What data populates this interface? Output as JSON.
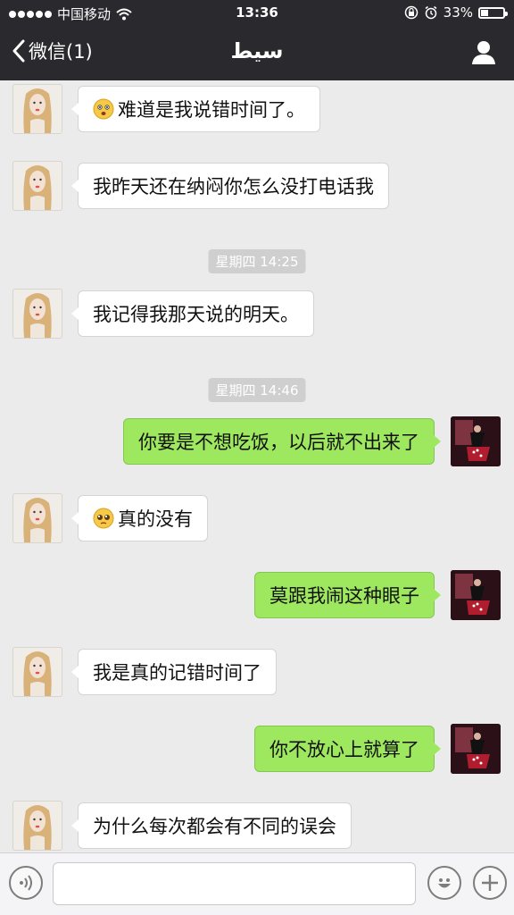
{
  "status_bar": {
    "carrier": "中国移动",
    "time": "13:36",
    "battery": "33%",
    "battery_level": 0.33
  },
  "nav": {
    "back_label": "微信(1)",
    "title": "سيط"
  },
  "messages": [
    {
      "side": "left",
      "text": "难道是我说错时间了。",
      "emoji": "surprised-emoji"
    },
    {
      "side": "left",
      "text": "我昨天还在纳闷你怎么没打电话我"
    },
    {
      "type": "timestamp",
      "text": "星期四 14:25"
    },
    {
      "side": "left",
      "text": "我记得我那天说的明天。"
    },
    {
      "type": "timestamp",
      "text": "星期四 14:46"
    },
    {
      "side": "right",
      "text": "你要是不想吃饭，以后就不出来了"
    },
    {
      "side": "left",
      "text": "真的没有",
      "emoji": "pleading-emoji"
    },
    {
      "side": "right",
      "text": "莫跟我闹这种眼子"
    },
    {
      "side": "left",
      "text": "我是真的记错时间了"
    },
    {
      "side": "right",
      "text": "你不放心上就算了"
    },
    {
      "side": "left",
      "text": "为什么每次都会有不同的误会"
    }
  ],
  "input": {
    "value": "",
    "placeholder": ""
  },
  "colors": {
    "bar_bg": "#2a2a2e",
    "chat_bg": "#ebebeb",
    "my_bubble": "#9ee85f",
    "their_bubble": "#ffffff"
  }
}
